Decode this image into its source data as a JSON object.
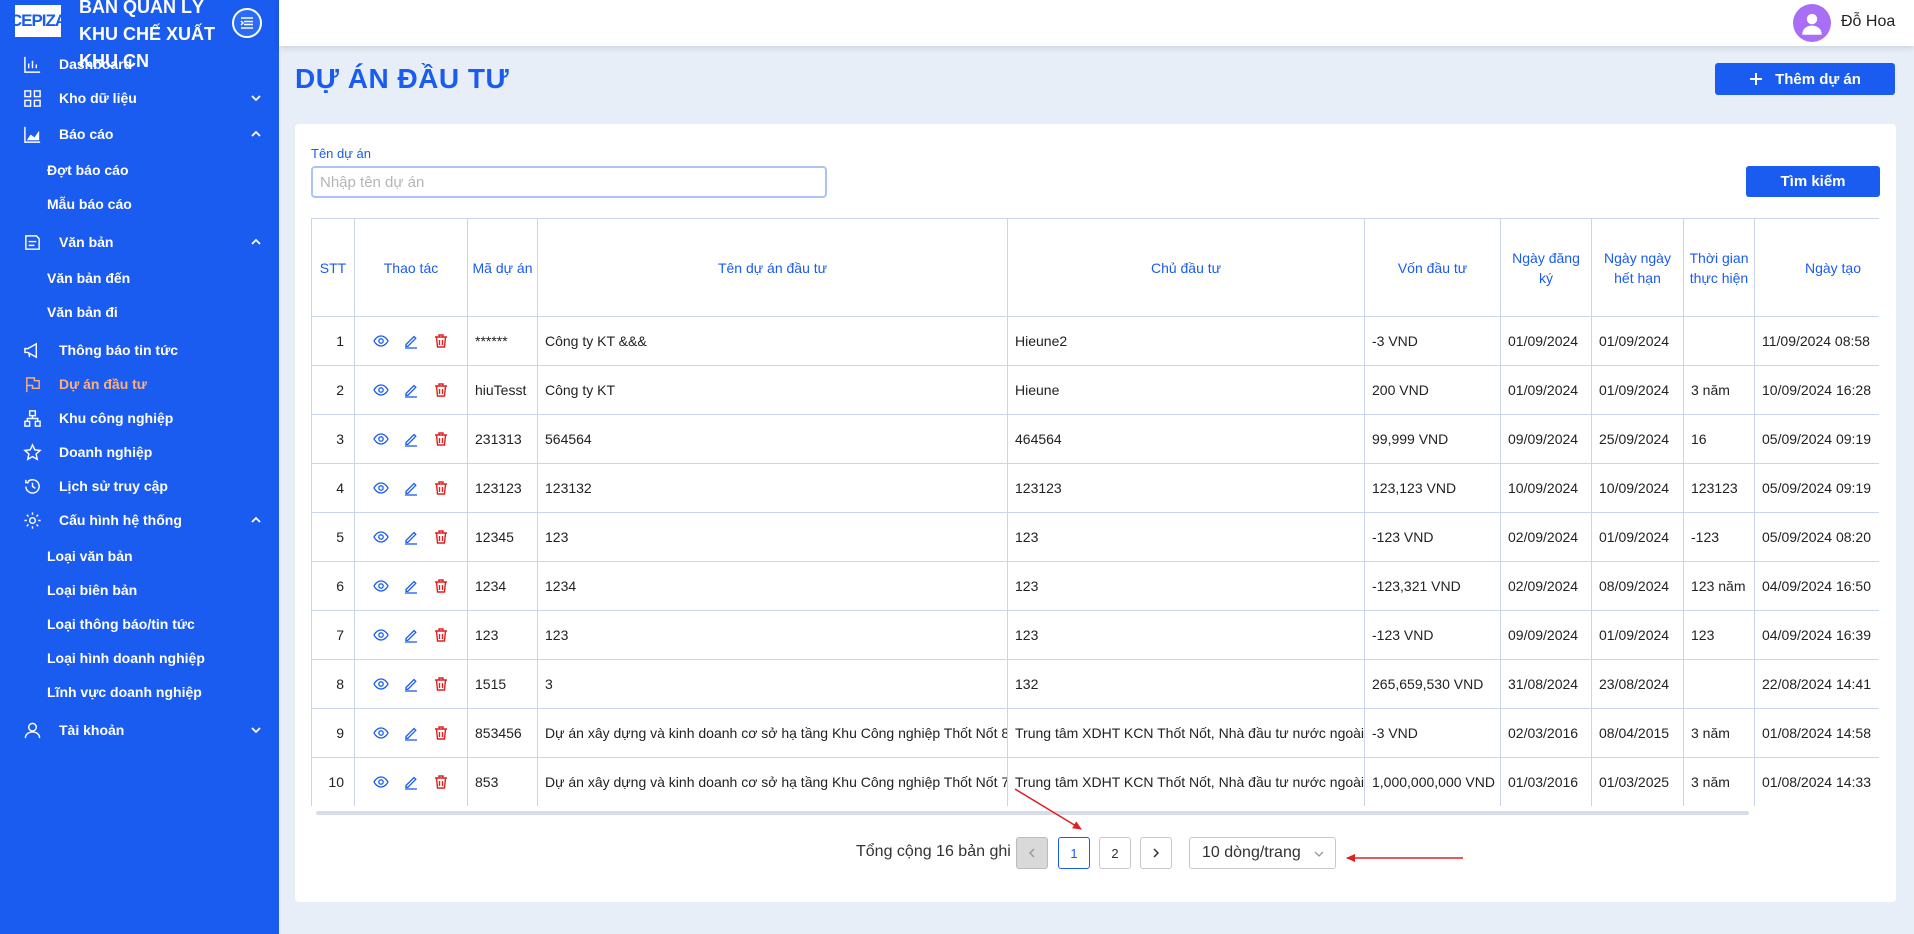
{
  "brand": {
    "logo_text": "CEPIZA",
    "name": "BAN QUẢN LÝ KHU CHẾ XUẤT KHU CN"
  },
  "sidebar": {
    "items": [
      {
        "label": "Dashboard",
        "icon": "bar-chart-icon"
      },
      {
        "label": "Kho dữ liệu",
        "icon": "grid-icon"
      },
      {
        "label": "Báo cáo",
        "icon": "area-chart-icon"
      },
      {
        "label": "Văn bản",
        "icon": "document-icon"
      },
      {
        "label": "Thông báo tin tức",
        "icon": "megaphone-icon"
      },
      {
        "label": "Dự án đầu tư",
        "icon": "flag-icon"
      },
      {
        "label": "Khu công nghiệp",
        "icon": "cluster-icon"
      },
      {
        "label": "Doanh nghiệp",
        "icon": "star-icon"
      },
      {
        "label": "Lịch sử truy cập",
        "icon": "history-icon"
      },
      {
        "label": "Cấu hình hệ thống",
        "icon": "gear-icon"
      },
      {
        "label": "Tài khoản",
        "icon": "user-icon"
      }
    ],
    "bao_cao_sub": [
      "Đợt báo cáo",
      "Mẫu báo cáo"
    ],
    "van_ban_sub": [
      "Văn bản đến",
      "Văn bản đi"
    ],
    "cau_hinh_sub": [
      "Loại văn bản",
      "Loại biên bản",
      "Loại thông báo/tin tức",
      "Loại hình doanh nghiệp",
      "Lĩnh vực doanh nghiệp"
    ],
    "active_color": "#ffb07a",
    "background": "#1a5cf0"
  },
  "user": {
    "name": "Đỗ Hoa"
  },
  "page": {
    "title": "DỰ ÁN ĐẦU TƯ",
    "add_button": "Thêm dự án",
    "search_label": "Tên dự án",
    "search_placeholder": "Nhập tên dự án",
    "search_button": "Tìm kiếm"
  },
  "table": {
    "headers": {
      "stt": "STT",
      "actions": "Thao tác",
      "code": "Mã dự án",
      "name": "Tên dự án đầu tư",
      "owner": "Chủ đầu tư",
      "capital": "Vốn đầu tư",
      "reg_date": "Ngày đăng ký",
      "exp_date": "Ngày ngày hết hạn",
      "duration": "Thời gian thực hiện",
      "created": "Ngày tạo"
    },
    "rows": [
      {
        "stt": "1",
        "code": "******",
        "name": "Công ty KT &&&",
        "owner": "Hieune2",
        "capital": "-3 VND",
        "reg": "01/09/2024",
        "exp": "01/09/2024",
        "duration": "",
        "created": "11/09/2024 08:58"
      },
      {
        "stt": "2",
        "code": "hiuTesst",
        "name": "Công ty KT",
        "owner": "Hieune",
        "capital": "200 VND",
        "reg": "01/09/2024",
        "exp": "01/09/2024",
        "duration": "3 năm",
        "created": "10/09/2024 16:28"
      },
      {
        "stt": "3",
        "code": "231313",
        "name": "564564",
        "owner": "464564",
        "capital": "99,999 VND",
        "reg": "09/09/2024",
        "exp": "25/09/2024",
        "duration": "16",
        "created": "05/09/2024 09:19"
      },
      {
        "stt": "4",
        "code": "123123",
        "name": "123132",
        "owner": "123123",
        "capital": "123,123 VND",
        "reg": "10/09/2024",
        "exp": "10/09/2024",
        "duration": "123123",
        "created": "05/09/2024 09:19"
      },
      {
        "stt": "5",
        "code": "12345",
        "name": "123",
        "owner": "123",
        "capital": "-123 VND",
        "reg": "02/09/2024",
        "exp": "01/09/2024",
        "duration": "-123",
        "created": "05/09/2024 08:20"
      },
      {
        "stt": "6",
        "code": "1234",
        "name": "1234",
        "owner": "123",
        "capital": "-123,321 VND",
        "reg": "02/09/2024",
        "exp": "08/09/2024",
        "duration": "123 năm",
        "created": "04/09/2024 16:50"
      },
      {
        "stt": "7",
        "code": "123",
        "name": "123",
        "owner": "123",
        "capital": "-123 VND",
        "reg": "09/09/2024",
        "exp": "01/09/2024",
        "duration": "123",
        "created": "04/09/2024 16:39"
      },
      {
        "stt": "8",
        "code": "1515",
        "name": "3",
        "owner": "132",
        "capital": "265,659,530 VND",
        "reg": "31/08/2024",
        "exp": "23/08/2024",
        "duration": "",
        "created": "22/08/2024 14:41"
      },
      {
        "stt": "9",
        "code": "853456",
        "name": "Dự án xây dựng và kinh doanh cơ sở hạ tầng Khu Công nghiệp Thốt Nốt 8",
        "owner": "Trung tâm XDHT KCN Thốt Nốt, Nhà đầu tư nước ngoài",
        "capital": "-3 VND",
        "reg": "02/03/2016",
        "exp": "08/04/2015",
        "duration": "3 năm",
        "created": "01/08/2024 14:58"
      },
      {
        "stt": "10",
        "code": "853",
        "name": "Dự án xây dựng và kinh doanh cơ sở hạ tầng Khu Công nghiệp Thốt Nốt 7",
        "owner": "Trung tâm XDHT KCN Thốt Nốt, Nhà đầu tư nước ngoài",
        "capital": "1,000,000,000 VND",
        "reg": "01/03/2016",
        "exp": "01/03/2025",
        "duration": "3 năm",
        "created": "01/08/2024 14:33"
      }
    ]
  },
  "pagination": {
    "total_text": "Tổng cộng 16 bản ghi",
    "pages": [
      "1",
      "2"
    ],
    "current": "1",
    "page_size": "10 dòng/trang"
  },
  "colors": {
    "accent": "#1a5cf0",
    "annotation": "#e02020",
    "delete": "#e02020"
  }
}
